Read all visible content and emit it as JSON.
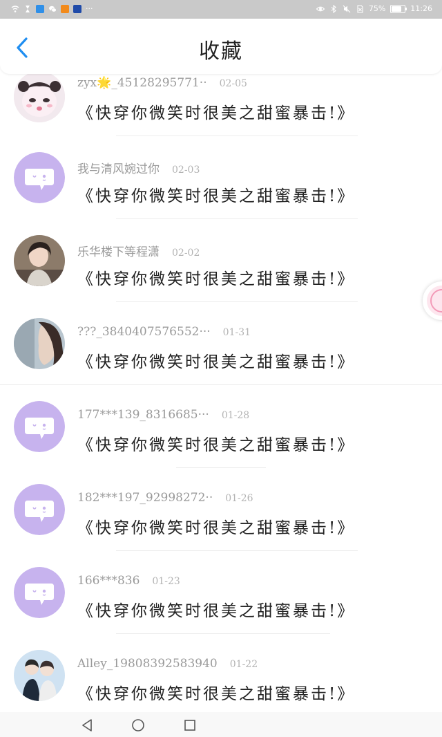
{
  "statusbar": {
    "battery_text": "75%",
    "time": "11:26",
    "battery_level": 0.75,
    "icons": [
      "wifi-icon",
      "hourglass-icon",
      "search-app-icon",
      "wechat-icon",
      "orange-app-icon",
      "blue-app-icon",
      "more-icon",
      "eye-icon",
      "bluetooth-icon",
      "mute-icon",
      "no-sim-icon"
    ],
    "more_text": "···"
  },
  "header": {
    "title": "收藏",
    "back_icon": "chevron-left-icon",
    "accent": "#1f8ef1"
  },
  "list": {
    "items": [
      {
        "name": "zyx🌟_45128295771··",
        "date": "02-05",
        "message": "《快穿你微笑时很美之甜蜜暴击!》",
        "avatar": "panda-cartoon-avatar"
      },
      {
        "name": "我与清风婉过你",
        "date": "02-03",
        "message": "《快穿你微笑时很美之甜蜜暴击!》",
        "avatar": "default-chat-avatar"
      },
      {
        "name": "乐华楼下等程潇",
        "date": "02-02",
        "message": "《快穿你微笑时很美之甜蜜暴击!》",
        "avatar": "photo-girl-avatar"
      },
      {
        "name": "???_3840407576552···",
        "date": "01-31",
        "message": "《快穿你微笑时很美之甜蜜暴击!》",
        "avatar": "photo-profile-avatar"
      },
      {
        "name": "177***139_8316685···",
        "date": "01-28",
        "message": "《快穿你微笑时很美之甜蜜暴击!》",
        "avatar": "default-chat-avatar"
      },
      {
        "name": "182***197_92998272··",
        "date": "01-26",
        "message": "《快穿你微笑时很美之甜蜜暴击!》",
        "avatar": "default-chat-avatar"
      },
      {
        "name": "166***836",
        "date": "01-23",
        "message": "《快穿你微笑时很美之甜蜜暴击!》",
        "avatar": "default-chat-avatar"
      },
      {
        "name": "Alley_19808392583940",
        "date": "01-22",
        "message": "《快穿你微笑时很美之甜蜜暴击!》",
        "avatar": "photo-couple-avatar"
      }
    ],
    "avatar_purple": "#c7b3ee"
  },
  "navbar": {
    "back": "triangle-back-icon",
    "home": "circle-home-icon",
    "recents": "square-recents-icon"
  }
}
